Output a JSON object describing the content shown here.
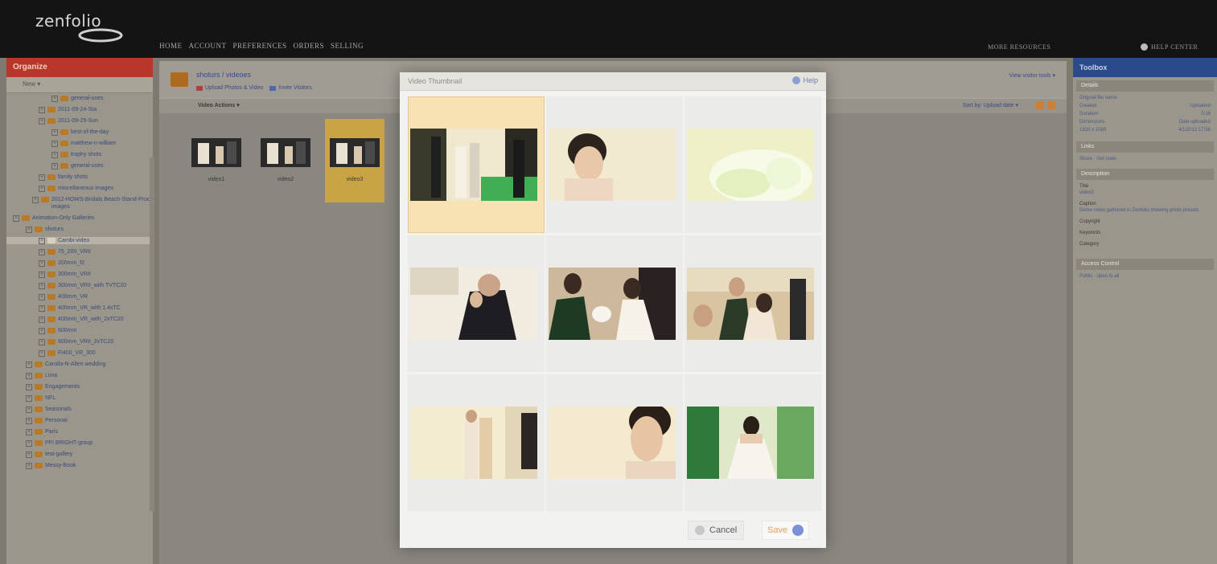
{
  "app": {
    "logo": "zenfolio"
  },
  "nav": {
    "items": [
      "HOME",
      "ACCOUNT",
      "PREFERENCES",
      "ORDERS",
      "SELLING"
    ],
    "more_resources": "MORE RESOURCES",
    "help_center": "HELP CENTER"
  },
  "organizer": {
    "title": "Organize",
    "toolbar": "New ▾",
    "tree": [
      {
        "label": "general-uses"
      },
      {
        "label": "2011-09-24-Sta"
      },
      {
        "label": "2011-09-25-Sun"
      },
      {
        "label": "best-of-the-day"
      },
      {
        "label": "matthew-n-william"
      },
      {
        "label": "trophy shots"
      },
      {
        "label": "general-uses"
      },
      {
        "label": "family shots"
      },
      {
        "label": "miscellaneous images"
      },
      {
        "label": "2012-HOWS-Bridals Beach-Stand-Proc images"
      },
      {
        "label": "Animation-Only Galleries"
      },
      {
        "label": "shoturs"
      },
      {
        "label": "Cambi-video",
        "selected": true
      },
      {
        "label": "75_200_VRII"
      },
      {
        "label": "200mm_f2"
      },
      {
        "label": "300mm_VRII"
      },
      {
        "label": "300mm_VRII_with TVTC20"
      },
      {
        "label": "400mm_VR"
      },
      {
        "label": "400mm_VR_with 1.4xTC"
      },
      {
        "label": "400mm_VR_with_2xTC20"
      },
      {
        "label": "600mm"
      },
      {
        "label": "600mm_VRII_2xTC20"
      },
      {
        "label": "Fi400_VR_300"
      },
      {
        "label": "Carolla-N-Allen wedding"
      },
      {
        "label": "Lima"
      },
      {
        "label": "Engagements"
      },
      {
        "label": "NFL"
      },
      {
        "label": "Seasonals"
      },
      {
        "label": "Personal"
      },
      {
        "label": "Paris"
      },
      {
        "label": "PFI BRIGHT-group"
      },
      {
        "label": "test-gallery"
      },
      {
        "label": "Messy-Book"
      }
    ]
  },
  "gallery": {
    "path": "shoturs / videoes",
    "actions": [
      "Upload Photos & Video",
      "Invite Visitors"
    ],
    "right_link": "View visitor tools ▾",
    "video_actions": "Video Actions ▾",
    "sort_by_label": "Sort by:",
    "sort_by_value": "Upload date ▾",
    "thumbs": [
      {
        "caption": "video1",
        "selected": false
      },
      {
        "caption": "video2",
        "selected": false
      },
      {
        "caption": "video3",
        "selected": true
      }
    ]
  },
  "toolbox": {
    "title": "Toolbox",
    "sections": {
      "details": "Details",
      "links": "Links",
      "description": "Description",
      "access": "Access Control"
    },
    "details_rows": [
      {
        "k": "Original file name",
        "v": ""
      },
      {
        "k": "Created",
        "v": "Uploaded"
      },
      {
        "k": "Duration",
        "v": "0:16"
      },
      {
        "k": "Dimensions",
        "v": "Date uploaded"
      },
      {
        "k": "1920 x 1080",
        "v": "4/1/2012 17:56"
      }
    ],
    "links_text": "Share · Get code",
    "description_rows": [
      {
        "lbl": "Title",
        "v": "video3"
      },
      {
        "lbl": "Caption",
        "v": "Demo video gathered in Zenfolio showing photo presets"
      },
      {
        "lbl": "Copyright",
        "v": ""
      },
      {
        "lbl": "Keywords",
        "v": ""
      },
      {
        "lbl": "Category",
        "v": ""
      }
    ],
    "access_text": "Public - open to all"
  },
  "dialog": {
    "title": "Video Thumbnail",
    "help": "Help",
    "cancel": "Cancel",
    "save": "Save",
    "frames": [
      {
        "name": "frame-1",
        "selected": true
      },
      {
        "name": "frame-2",
        "selected": false
      },
      {
        "name": "frame-3",
        "selected": false
      },
      {
        "name": "frame-4",
        "selected": false
      },
      {
        "name": "frame-5",
        "selected": false
      },
      {
        "name": "frame-6",
        "selected": false
      },
      {
        "name": "frame-7",
        "selected": false
      },
      {
        "name": "frame-8",
        "selected": false
      },
      {
        "name": "frame-9",
        "selected": false
      }
    ]
  },
  "colors": {
    "topbar": "#141414",
    "organizer_header": "#b8372a",
    "toolbox_header": "#2a4a8a",
    "selection": "#f8e2b4"
  }
}
